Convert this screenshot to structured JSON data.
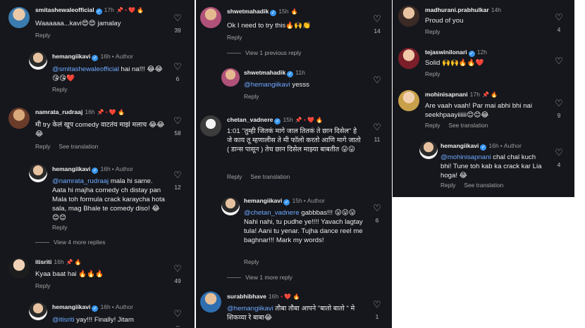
{
  "columns": [
    {
      "comments": [
        {
          "user": "smitashewaleofficial",
          "verified": true,
          "time": "17h",
          "tags": "📌 • ❤️ 🔥",
          "text": "Waaaaaa...kavi😍😍 jamalay",
          "reply": "Reply",
          "see_translation": "",
          "likes": "39"
        },
        {
          "user": "hemangiikavi",
          "verified": true,
          "time": "16h",
          "author": "• Author",
          "tags": "",
          "text_mention": "@smitashewaleofficial",
          "text": " hai na!!! 😂😂😘😘❤️",
          "reply": "Reply",
          "see_translation": "",
          "likes": "6"
        },
        {
          "user": "namrata_rudraaj",
          "verified": false,
          "time": "16h",
          "tags": "📌 • ❤️ 🔥",
          "text": "मी try केलं खूप comedy वाटतंय माझं मलाच 😂😂😂",
          "reply": "Reply",
          "see_translation": "See translation",
          "likes": "58"
        },
        {
          "user": "hemangiikavi",
          "verified": true,
          "time": "16h",
          "author": "• Author",
          "tags": "",
          "text_mention": "@namrata_rudraaj",
          "text": " mala hi same. Aata hi majha comedy ch distay pan Mala toh formula crack karaycha hota sala, mag Bhale te comedy diso! 😂😊😊",
          "reply": "Reply",
          "see_translation": "",
          "likes": "12"
        },
        {
          "user": "itisriti",
          "verified": false,
          "time": "16h",
          "tags": "📌 🔥",
          "text": "Kyaa baat hai 🔥🔥🔥",
          "reply": "Reply",
          "see_translation": "",
          "likes": "49"
        },
        {
          "user": "hemangiikavi",
          "verified": true,
          "time": "16h",
          "author": "• Author",
          "tags": "",
          "text_mention": "@itisriti",
          "text": " yay!!! Finally! Jitam",
          "reply": "",
          "see_translation": "",
          "likes": "--"
        }
      ],
      "view_more": "View 4 more replies"
    },
    {
      "comments": [
        {
          "user": "shwetmahadik",
          "verified": true,
          "time": "15h",
          "tags": "🔥",
          "text": "Ok I need to try this🔥🙌👏",
          "reply": "Reply",
          "see_translation": "",
          "likes": "14"
        },
        {
          "user": "shwetmahadik",
          "verified": true,
          "time": "11h",
          "tags": "",
          "text_mention": "@hemangiikavi",
          "text": " yesss",
          "reply": "Reply",
          "see_translation": "",
          "likes": ""
        },
        {
          "user": "chetan_vadnere",
          "verified": true,
          "time": "15h",
          "tags": "📌 • ❤️ 🔥",
          "text": "1:01 \"तुम्ही जितकं मागे जाल तितकं ते छान दिसेल\" हे जे काय तू म्हणालीस ते मी फॉलो करतो आणि मागे जातो ( डान्स पासून ) तेच छान दिसेल माझ्या बाबतीत 😛😛",
          "reply": "Reply",
          "see_translation": "See translation",
          "likes": "11"
        },
        {
          "user": "hemangiikavi",
          "verified": true,
          "time": "15h",
          "author": "• Author",
          "tags": "",
          "text_mention": "@chetan_vadnere",
          "text": " gabbbas!!! 😛😛😛Nahi nahi, tu pudhe ye!!!! Yavach lagtay tula! Aani tu yenar. Tujha dance reel me baghnar!!! Mark my words!",
          "reply": "Reply",
          "see_translation": "",
          "likes": "6"
        },
        {
          "user": "surabhibhave",
          "verified": false,
          "time": "16h",
          "tags": "• ❤️ 🔥",
          "text_mention": "@hemangiikavi",
          "text": " तौबा तौबा आपने \"बातो बातो \" मे शिकव्या रे बाबा😂",
          "reply": "",
          "see_translation": "",
          "likes": "1"
        }
      ],
      "view_previous": "View 1 previous reply",
      "view_more": "View 1 more reply"
    },
    {
      "comments": [
        {
          "user": "madhurani.prabhulkar",
          "verified": false,
          "time": "14h",
          "tags": "",
          "text": "Proud of you",
          "reply": "Reply",
          "see_translation": "",
          "likes": "4"
        },
        {
          "user": "tejaswinilonari",
          "verified": true,
          "time": "12h",
          "tags": "",
          "text": "Solid 🙌🙌🔥🔥❤️",
          "reply": "Reply",
          "see_translation": "",
          "likes": ""
        },
        {
          "user": "mohinisapnani",
          "verified": false,
          "time": "17h",
          "tags": "📌 🔥",
          "text": "Are vaah vaah! Par mai abhi bhi nai seekhpaayiiiiii😊😊😂",
          "reply": "Reply",
          "see_translation": "See translation",
          "likes": "9"
        },
        {
          "user": "hemangiikavi",
          "verified": true,
          "time": "16h",
          "author": "• Author",
          "tags": "",
          "text_mention": "@mohinisapnani",
          "text": " chal chal kuch bhi! Tune toh kab ka crack kar Lia hoga! 😂",
          "reply": "Reply",
          "see_translation": "See translation",
          "likes": "4"
        }
      ]
    }
  ],
  "icons": {
    "heart": "heart-outline-icon",
    "verified": "verified-badge-icon"
  },
  "colors": {
    "panel_bg": "#15171c",
    "mention": "#6fa8ff",
    "verified": "#3897f0",
    "heart": "#ed2b3f"
  }
}
